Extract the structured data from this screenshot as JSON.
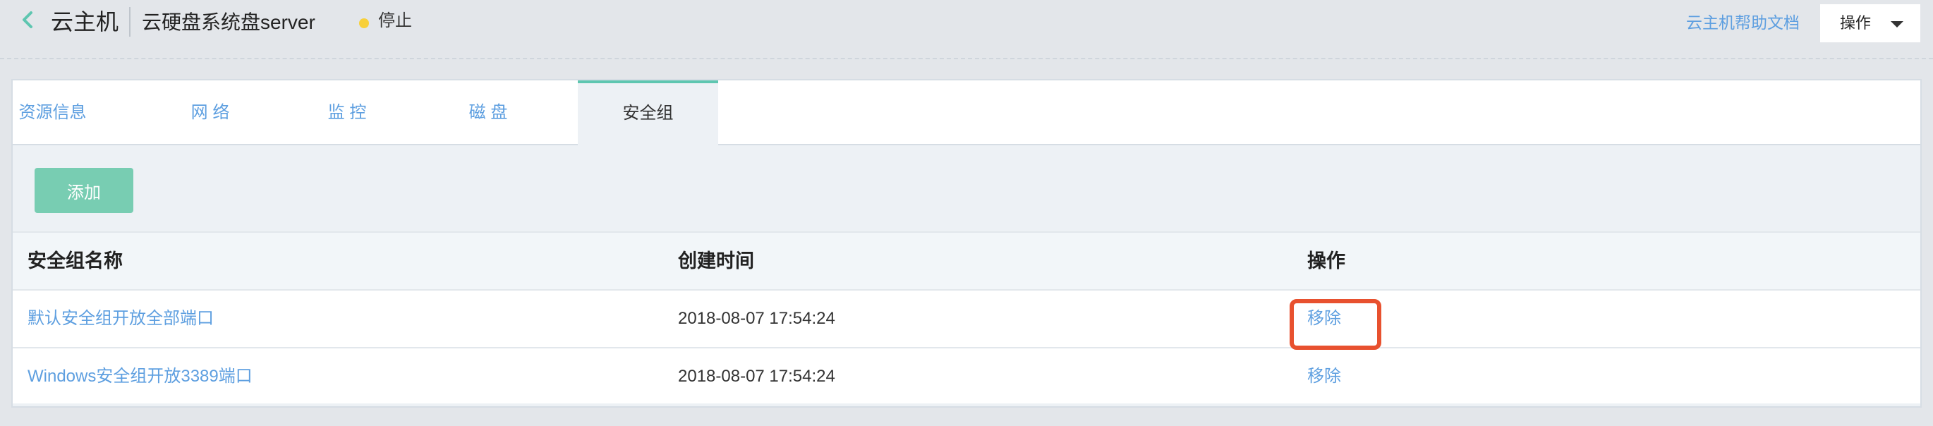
{
  "header": {
    "title": "云主机",
    "subtitle": "云硬盘系统盘server",
    "status": "停止",
    "help_link": "云主机帮助文档",
    "ops_label": "操作"
  },
  "tabs": [
    {
      "label": "资源信息",
      "active": false
    },
    {
      "label": "网 络",
      "active": false
    },
    {
      "label": "监 控",
      "active": false
    },
    {
      "label": "磁 盘",
      "active": false
    },
    {
      "label": "安全组",
      "active": true
    }
  ],
  "actions": {
    "add_label": "添加"
  },
  "table": {
    "headers": [
      "安全组名称",
      "创建时间",
      "操作"
    ],
    "rows": [
      {
        "name": "默认安全组开放全部端口",
        "created": "2018-08-07 17:54:24",
        "action": "移除"
      },
      {
        "name": "Windows安全组开放3389端口",
        "created": "2018-08-07 17:54:24",
        "action": "移除"
      }
    ]
  },
  "icons": {
    "back": "chevron-left-icon",
    "status": "status-dot-icon",
    "dropdown": "caret-down-icon"
  },
  "colors": {
    "accent": "#5ec6b0",
    "link": "#5e9fe0",
    "highlight": "#e8512f",
    "status": "#f8d03a",
    "add_button": "#78cdb2"
  }
}
